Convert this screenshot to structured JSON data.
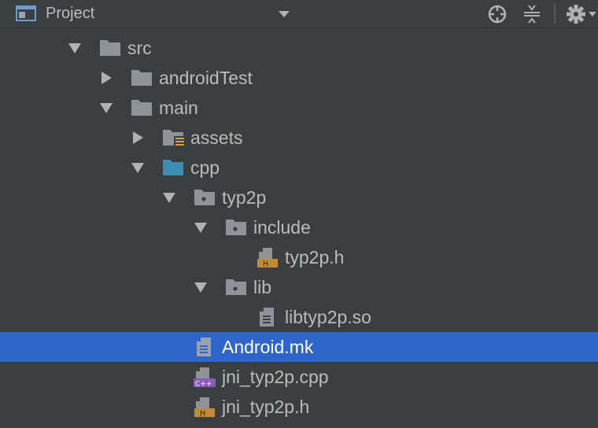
{
  "toolbar": {
    "title": "Project",
    "icons": [
      "project-view-icon",
      "chevron-down-icon",
      "locate-target-icon",
      "collapse-all-icon",
      "gear-icon"
    ]
  },
  "colors": {
    "folder": "#8d949c",
    "source_folder": "#3d8eb5",
    "header_badge": "#c08a36",
    "cpp_badge": "#8c5bb8",
    "selection": "#2f65ca"
  },
  "tree": {
    "nodes": [
      {
        "label": "src",
        "icon": "folder-icon",
        "expanded": true
      },
      {
        "label": "androidTest",
        "icon": "folder-icon",
        "expanded": false
      },
      {
        "label": "main",
        "icon": "folder-icon",
        "expanded": true
      },
      {
        "label": "assets",
        "icon": "resource-folder-icon",
        "expanded": false
      },
      {
        "label": "cpp",
        "icon": "source-folder-icon",
        "expanded": true
      },
      {
        "label": "typ2p",
        "icon": "package-folder-icon",
        "expanded": true
      },
      {
        "label": "include",
        "icon": "package-folder-icon",
        "expanded": true
      },
      {
        "label": "typ2p.h",
        "icon": "header-file-icon",
        "badge": "H"
      },
      {
        "label": "lib",
        "icon": "package-folder-icon",
        "expanded": true
      },
      {
        "label": "libtyp2p.so",
        "icon": "text-file-icon"
      },
      {
        "label": "Android.mk",
        "icon": "text-file-icon",
        "selected": true
      },
      {
        "label": "jni_typ2p.cpp",
        "icon": "cpp-file-icon",
        "badge": "C++"
      },
      {
        "label": "jni_typ2p.h",
        "icon": "header-file-icon",
        "badge": "H"
      }
    ]
  }
}
